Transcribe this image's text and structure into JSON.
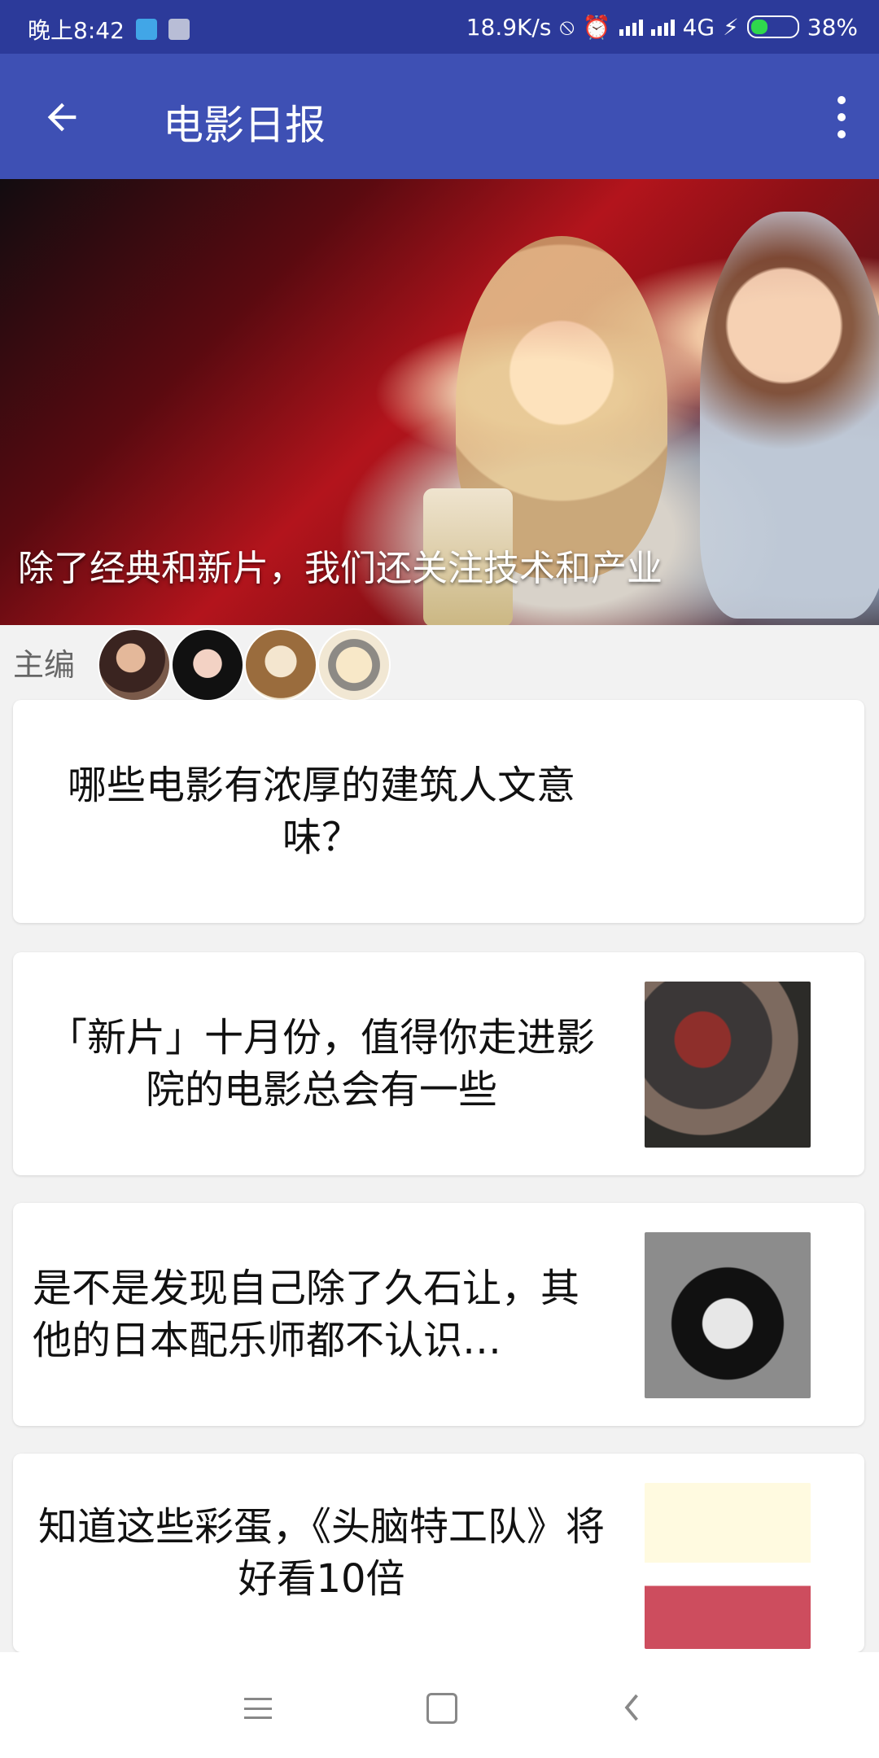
{
  "status_bar": {
    "time": "晚上8:42",
    "network_speed": "18.9K/s",
    "network_type": "4G",
    "battery": "38%"
  },
  "app_bar": {
    "title": "电影日报",
    "back_icon": "arrow-left",
    "menu_icon": "more-vertical"
  },
  "hero": {
    "caption": "除了经典和新片，我们还关注技术和产业"
  },
  "editors": {
    "label": "主编"
  },
  "articles": [
    {
      "title": "哪些电影有浓厚的建筑人文意味？",
      "has_thumbnail": false
    },
    {
      "title": "「新片」十月份，值得你走进影院的电影总会有一些",
      "has_thumbnail": true
    },
    {
      "title": "是不是发现自己除了久石让，其他的日本配乐师都不认识…",
      "has_thumbnail": true
    },
    {
      "title": "知道这些彩蛋，《头脑特工队》将好看10倍",
      "has_thumbnail": true
    }
  ],
  "nav_bar": {
    "menu_icon": "menu",
    "home_icon": "square",
    "back_icon": "chevron-left"
  }
}
